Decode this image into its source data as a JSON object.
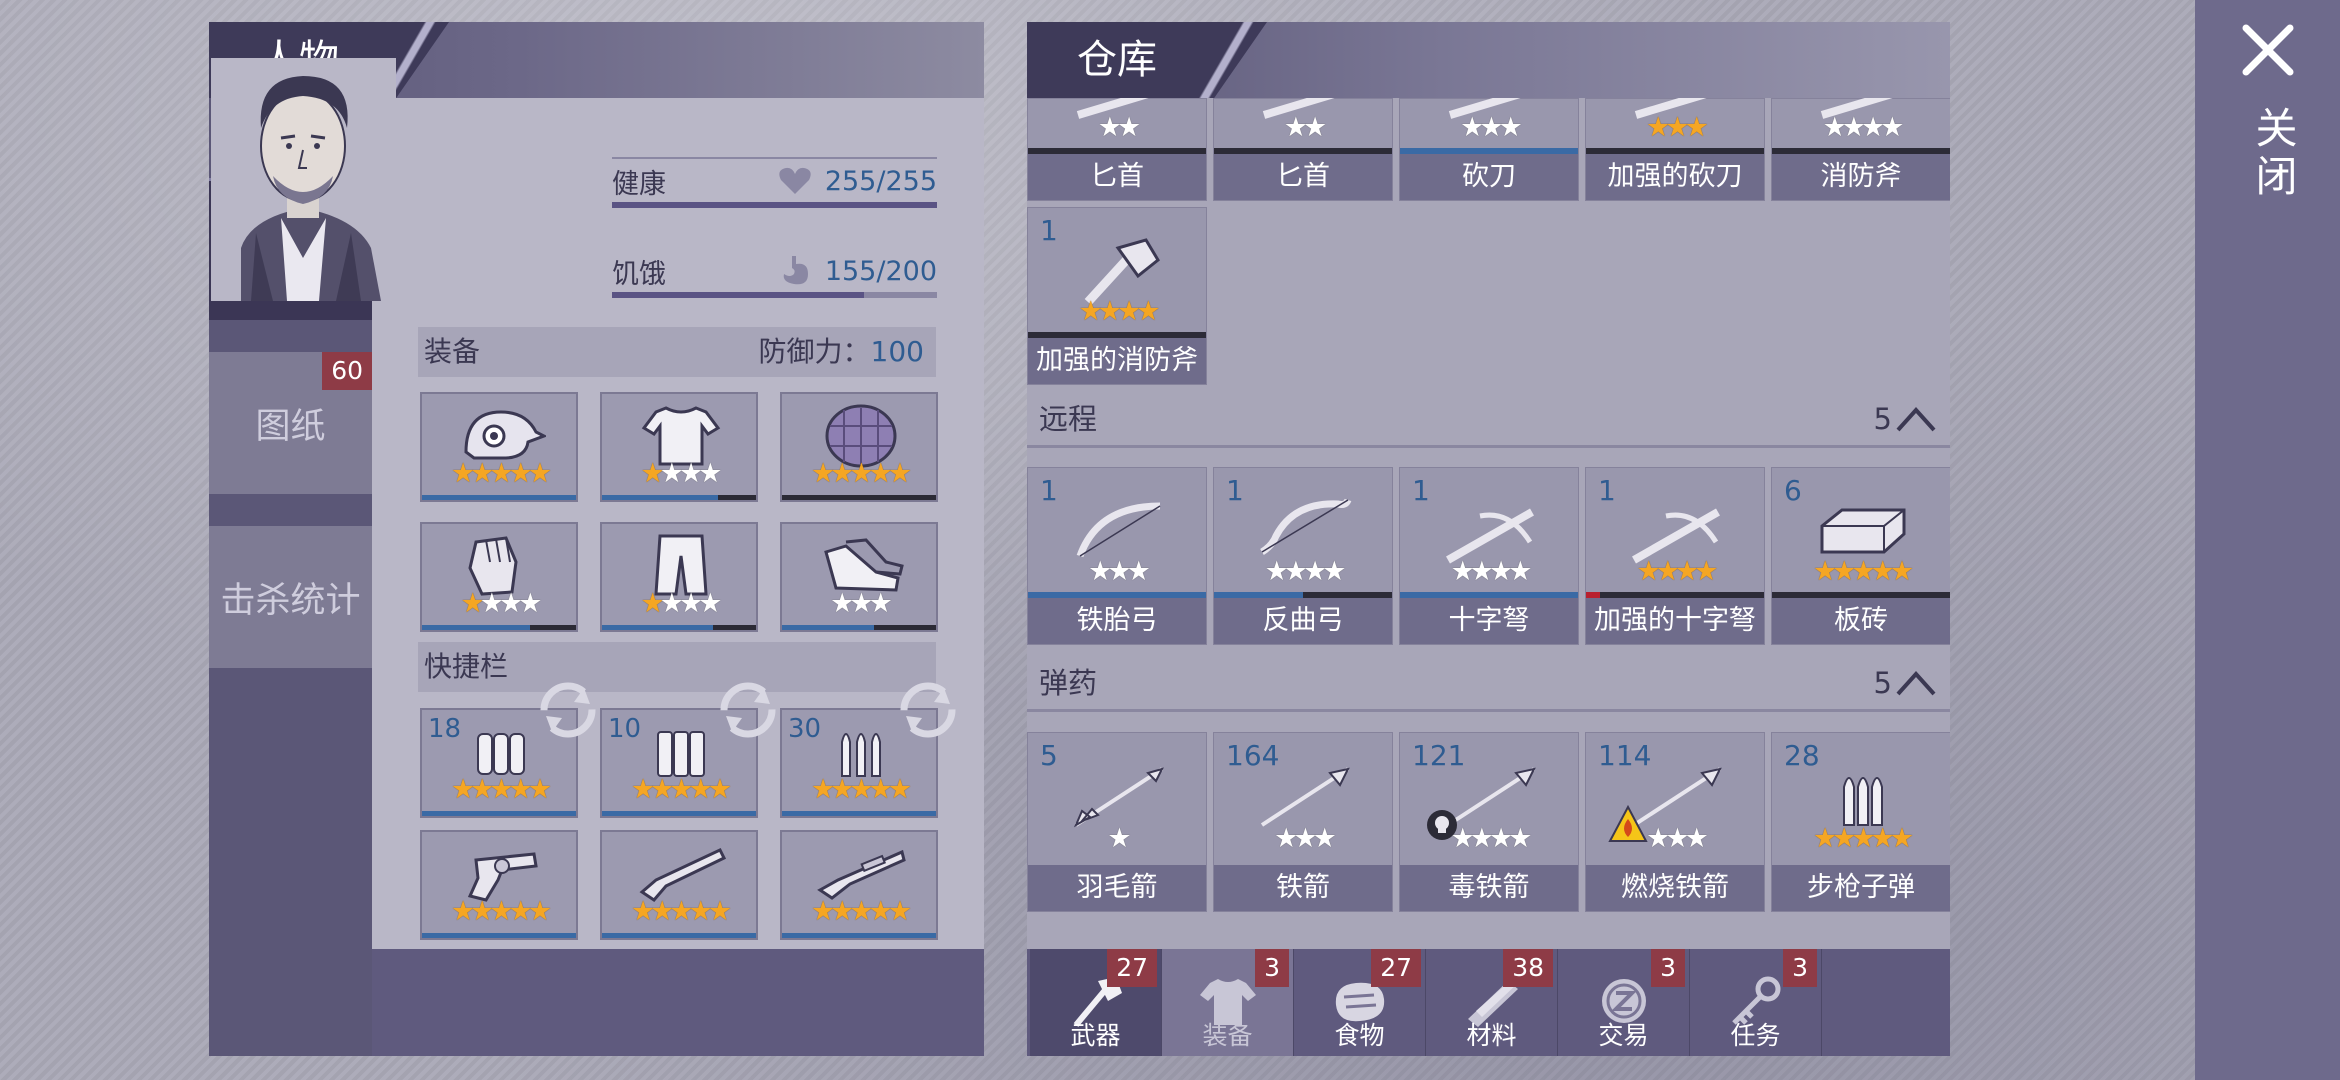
{
  "character": {
    "title": "人物",
    "tabs": [
      {
        "label": "装备"
      },
      {
        "label": "图纸",
        "badge": "60"
      },
      {
        "label": "击杀统计"
      }
    ],
    "stats": {
      "health_label": "健康",
      "health_value": "255/255",
      "health_fraction": 1.0,
      "hunger_label": "饥饿",
      "hunger_value": "155/200",
      "hunger_fraction": 0.775
    },
    "equipment": {
      "label": "装备",
      "defense_label": "防御力：",
      "defense_value": "100",
      "slots": [
        {
          "icon": "helmet-icon",
          "stars": 5,
          "max": 5,
          "durability": 1.0
        },
        {
          "icon": "shirt-icon",
          "stars": 1,
          "max": 4,
          "durability": 0.75
        },
        {
          "icon": "turtle-shell-icon",
          "stars": 5,
          "max": 5,
          "durability": 0.0
        },
        {
          "icon": "gloves-icon",
          "stars": 1,
          "max": 4,
          "durability": 0.7
        },
        {
          "icon": "pants-icon",
          "stars": 1,
          "max": 4,
          "durability": 0.72
        },
        {
          "icon": "shoes-icon",
          "stars": 0,
          "max": 3,
          "durability": 0.6
        }
      ]
    },
    "quickbar": {
      "label": "快捷栏",
      "slots": [
        {
          "icon": "bullets-icon",
          "count": "18",
          "stars": 5,
          "max": 5,
          "durability": 1.0
        },
        {
          "icon": "bullets-icon",
          "count": "10",
          "stars": 5,
          "max": 5,
          "durability": 1.0
        },
        {
          "icon": "rifle-bullets-icon",
          "count": "30",
          "stars": 5,
          "max": 5,
          "durability": 1.0
        },
        {
          "icon": "revolver-icon",
          "count": "",
          "stars": 5,
          "max": 5,
          "durability": 1.0
        },
        {
          "icon": "shotgun-icon",
          "count": "",
          "stars": 5,
          "max": 5,
          "durability": 1.0
        },
        {
          "icon": "rifle-icon",
          "count": "",
          "stars": 5,
          "max": 5,
          "durability": 1.0
        }
      ]
    }
  },
  "warehouse": {
    "title": "仓库",
    "melee_top_row": [
      {
        "name": "匕首",
        "icon": "dagger-icon",
        "stars": 0,
        "max": 2,
        "durability": 0.0
      },
      {
        "name": "匕首",
        "icon": "dagger-icon",
        "stars": 0,
        "max": 2,
        "durability": 0.0
      },
      {
        "name": "砍刀",
        "icon": "machete-icon",
        "stars": 0,
        "max": 3,
        "durability": 1.0
      },
      {
        "name": "加强的砍刀",
        "icon": "machete-icon",
        "stars": 3,
        "max": 3,
        "durability": 0.0
      },
      {
        "name": "消防斧",
        "icon": "fire-axe-icon",
        "stars": 0,
        "max": 4,
        "durability": 0.0
      }
    ],
    "melee_second_row": [
      {
        "name": "加强的消防斧",
        "icon": "fire-axe-icon",
        "count": "1",
        "stars": 4,
        "max": 4,
        "durability": 0.0
      }
    ],
    "ranged": {
      "label": "远程",
      "count": "5",
      "items": [
        {
          "name": "铁胎弓",
          "icon": "bow-icon",
          "count": "1",
          "stars": 0,
          "max": 3,
          "durability": 1.0
        },
        {
          "name": "反曲弓",
          "icon": "recurve-bow-icon",
          "count": "1",
          "stars": 0,
          "max": 4,
          "durability": 0.5
        },
        {
          "name": "十字弩",
          "icon": "crossbow-icon",
          "count": "1",
          "stars": 0,
          "max": 4,
          "durability": 1.0
        },
        {
          "name": "加强的十字弩",
          "icon": "crossbow-icon",
          "count": "1",
          "stars": 4,
          "max": 4,
          "durability": 0.08
        },
        {
          "name": "板砖",
          "icon": "brick-icon",
          "count": "6",
          "stars": 5,
          "max": 5,
          "durability": 0.0
        }
      ]
    },
    "ammo": {
      "label": "弹药",
      "count": "5",
      "items": [
        {
          "name": "羽毛箭",
          "icon": "feather-arrow-icon",
          "count": "5",
          "stars": 0,
          "max": 1
        },
        {
          "name": "铁箭",
          "icon": "iron-arrow-icon",
          "count": "164",
          "stars": 0,
          "max": 3
        },
        {
          "name": "毒铁箭",
          "icon": "poison-arrow-icon",
          "count": "121",
          "stars": 0,
          "max": 4
        },
        {
          "name": "燃烧铁箭",
          "icon": "fire-arrow-icon",
          "count": "114",
          "stars": 0,
          "max": 3
        },
        {
          "name": "步枪子弹",
          "icon": "rifle-bullets-icon",
          "count": "28",
          "stars": 5,
          "max": 5
        }
      ]
    },
    "bottom_tabs": [
      {
        "label": "武器",
        "badge": "27",
        "icon": "axe-icon"
      },
      {
        "label": "装备",
        "badge": "3",
        "icon": "shirt-icon"
      },
      {
        "label": "食物",
        "badge": "27",
        "icon": "meat-icon"
      },
      {
        "label": "材料",
        "badge": "38",
        "icon": "wood-icon"
      },
      {
        "label": "交易",
        "badge": "3",
        "icon": "coin-icon"
      },
      {
        "label": "任务",
        "badge": "3",
        "icon": "key-icon"
      }
    ]
  },
  "close": {
    "label": "关闭"
  }
}
